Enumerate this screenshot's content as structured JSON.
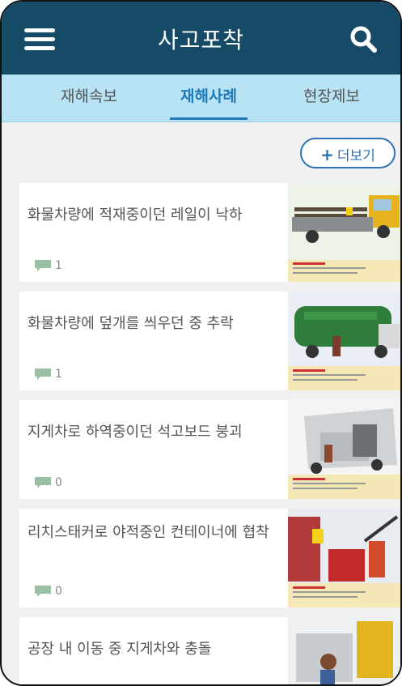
{
  "header": {
    "title": "사고포착"
  },
  "tabs": [
    {
      "label": "재해속보",
      "active": false
    },
    {
      "label": "재해사례",
      "active": true
    },
    {
      "label": "현장제보",
      "active": false
    }
  ],
  "more_button": {
    "icon": "plus-icon",
    "label": "더보기"
  },
  "articles": [
    {
      "title": "화물차량에 적재중이던 레일이 낙하",
      "comments": "1",
      "thumbnail": "truck-rail-illustration"
    },
    {
      "title": "화물차량에 덮개를 씌우던 중 추락",
      "comments": "1",
      "thumbnail": "truck-cover-illustration"
    },
    {
      "title": "지게차로 하역중이던 석고보드 붕괴",
      "comments": "0",
      "thumbnail": "forklift-board-illustration"
    },
    {
      "title": "리치스태커로 야적중인 컨테이너에 협착",
      "comments": "0",
      "thumbnail": "container-illustration"
    },
    {
      "title": "공장 내 이동 중 지게차와 충돌",
      "comments": "",
      "thumbnail": "factory-forklift-illustration"
    }
  ],
  "colors": {
    "appbar": "#164b67",
    "tabbar": "#b7e3f5",
    "accent": "#1f79b8"
  }
}
